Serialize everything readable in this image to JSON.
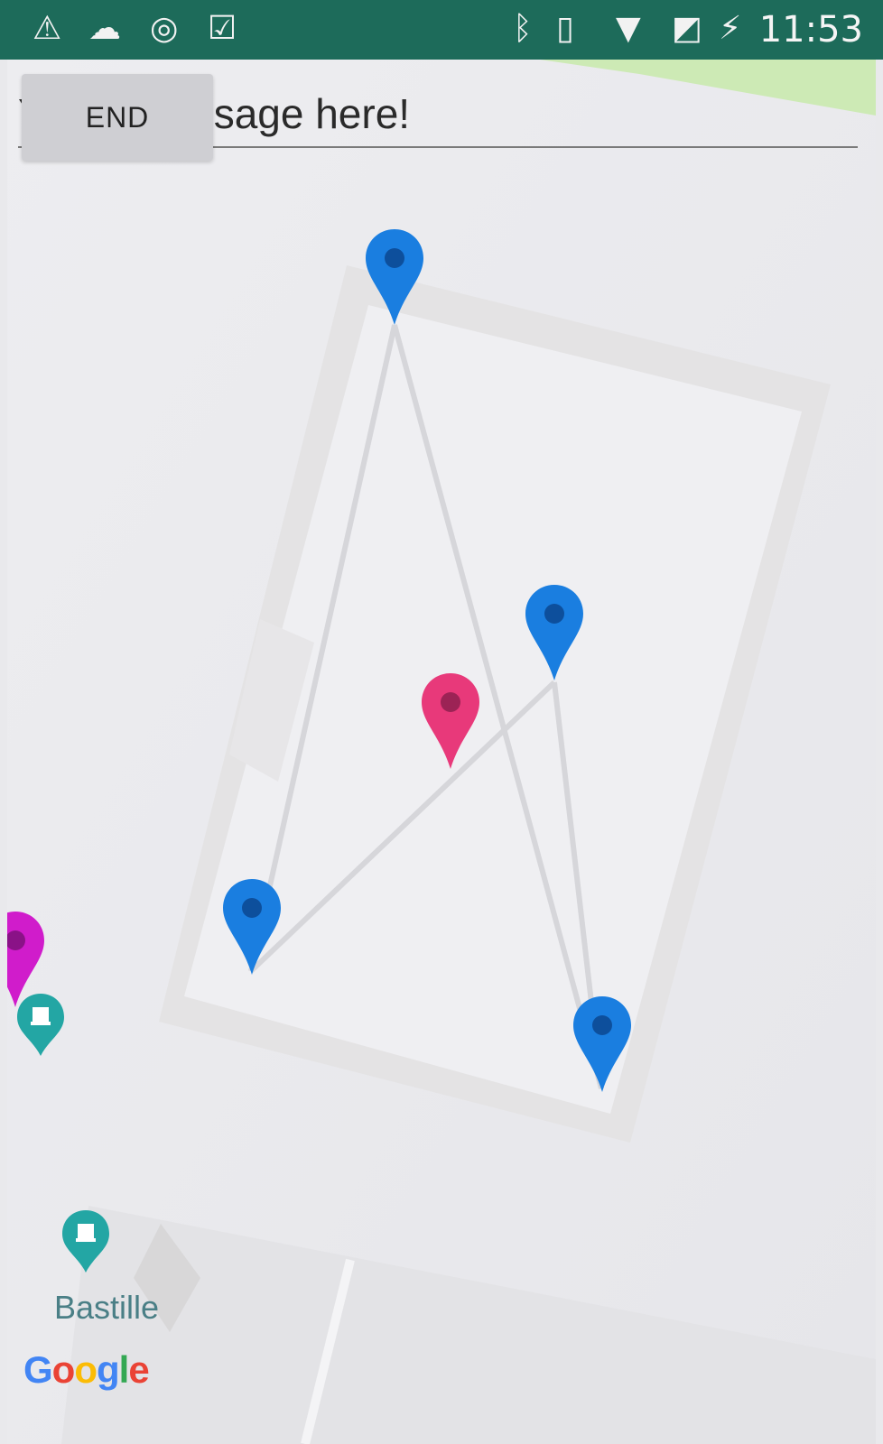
{
  "status_bar": {
    "left_icons": [
      "warning-icon",
      "cloud-icon",
      "location-target-icon",
      "task-check-icon"
    ],
    "right_icons": [
      "bluetooth-icon",
      "vibrate-icon",
      "wifi-icon",
      "no-sim-icon",
      "battery-charging-icon"
    ],
    "time": "11:53"
  },
  "message_input": {
    "visible_text": "sage here!",
    "partial_prefix": "Y"
  },
  "end_button": {
    "label": "END"
  },
  "map": {
    "poi_label": "Bastille",
    "attribution": [
      "G",
      "o",
      "o",
      "g",
      "l",
      "e"
    ],
    "colors": {
      "route_marker": "#1a7ee0",
      "center_marker": "#e8397a",
      "offscreen_marker": "#d01ccb",
      "poi_marker": "#23a6a4"
    }
  }
}
